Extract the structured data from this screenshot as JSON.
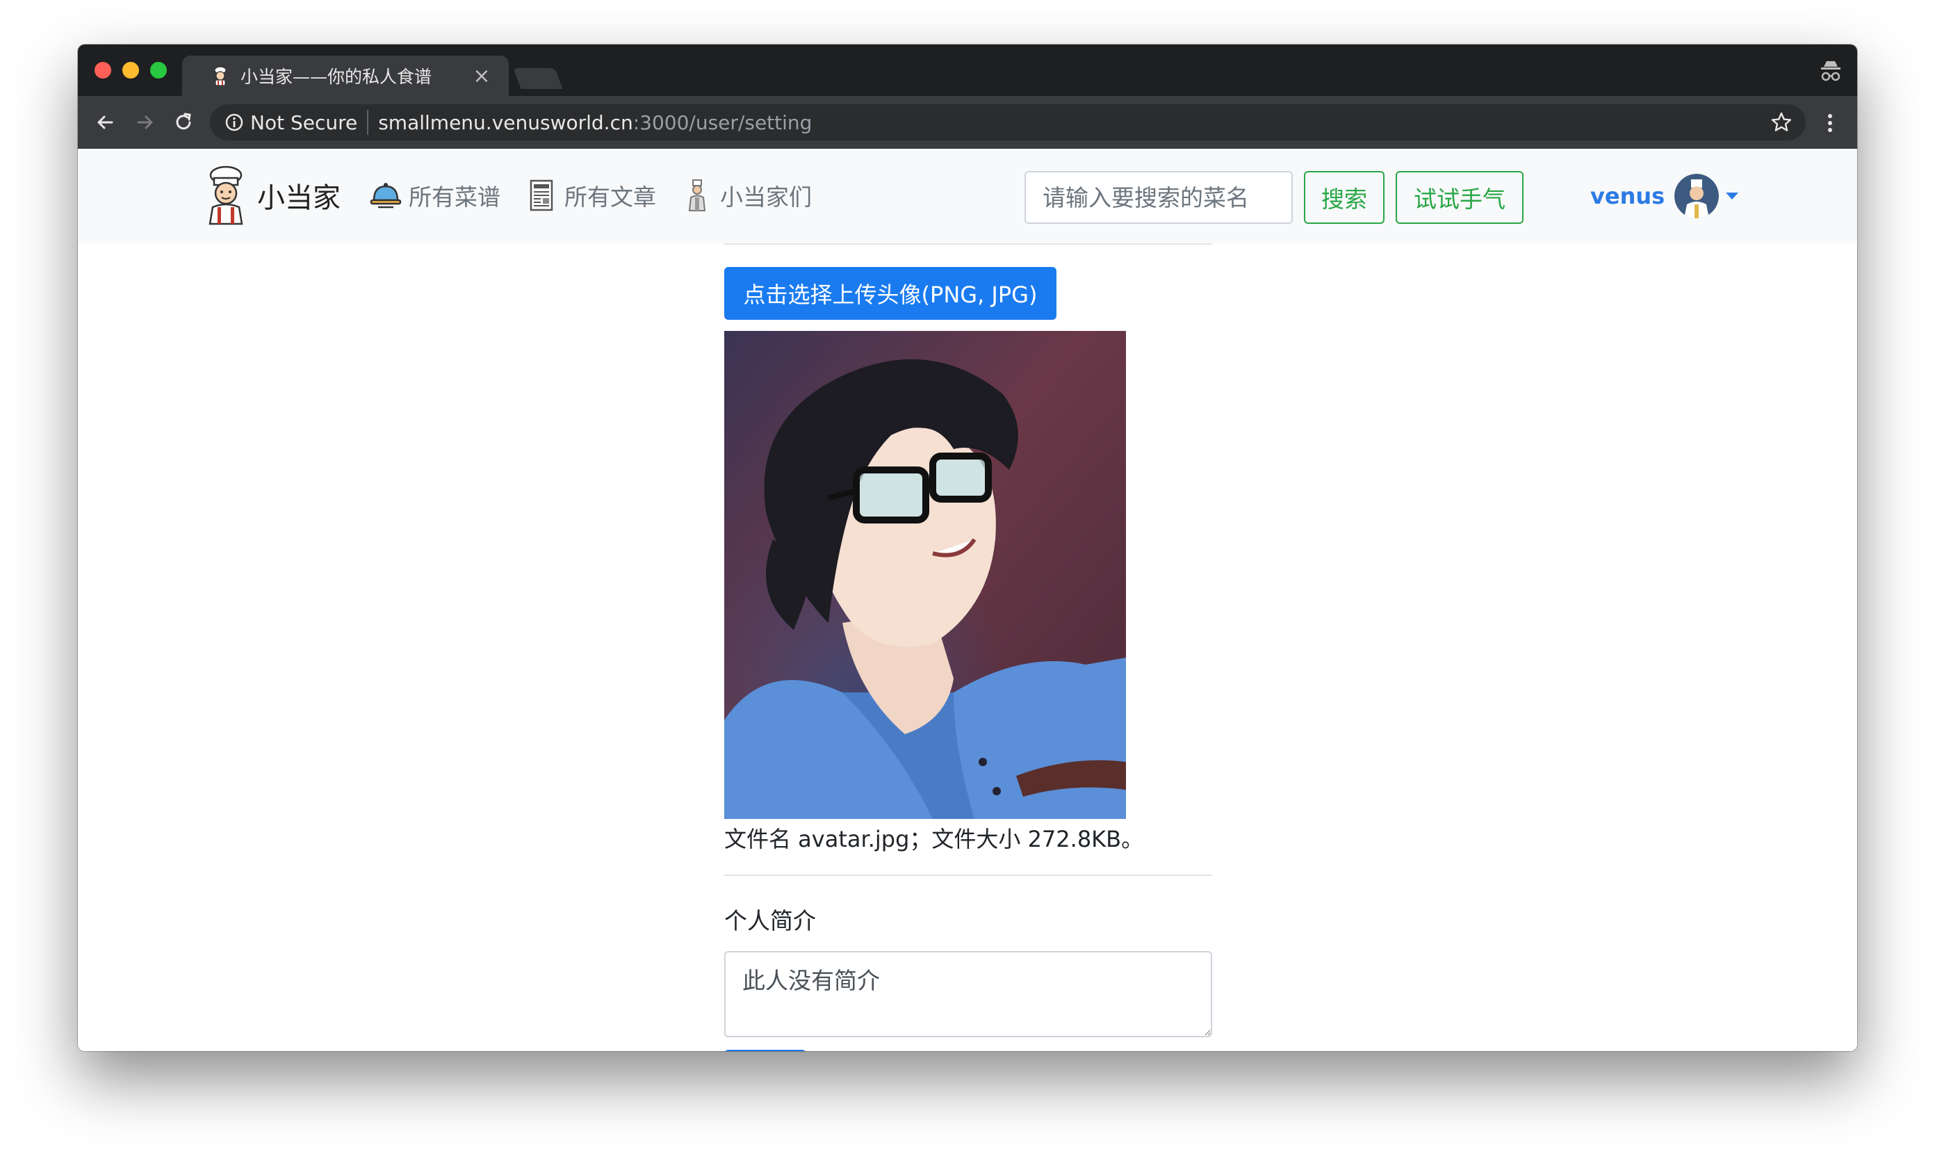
{
  "browser": {
    "tab_title": "小当家——你的私人食谱",
    "tab_close": "×",
    "security_label": "Not Secure",
    "url_host": "smallmenu.venusworld.cn",
    "url_path": ":3000/user/setting"
  },
  "site": {
    "brand": "小当家",
    "nav": [
      {
        "label": "所有菜谱",
        "icon": "food-tray-icon"
      },
      {
        "label": "所有文章",
        "icon": "newspaper-icon"
      },
      {
        "label": "小当家们",
        "icon": "chef-icon"
      }
    ],
    "search_placeholder": "请输入要搜索的菜名",
    "search_button": "搜索",
    "lucky_button": "试试手气",
    "username": "venus"
  },
  "form": {
    "upload_button": "点击选择上传头像(PNG, JPG)",
    "file_info": "文件名 avatar.jpg；文件大小 272.8KB。",
    "bio_label": "个人简介",
    "bio_value": "此人没有简介"
  },
  "colors": {
    "primary": "#1a7bf0",
    "success": "#28a745",
    "user_link": "#2c7be5"
  }
}
